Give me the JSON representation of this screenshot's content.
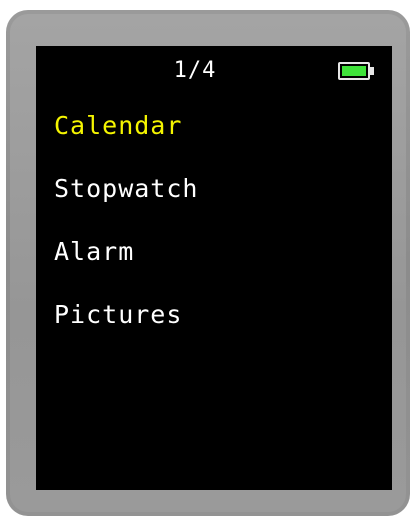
{
  "status": {
    "page_indicator": "1/4",
    "battery_level": 1.0,
    "battery_color": "#3fe23a",
    "battery_icon": "battery-icon"
  },
  "menu": {
    "selected_index": 0,
    "selected_color": "#f5f500",
    "items": [
      {
        "label": "Calendar"
      },
      {
        "label": "Stopwatch"
      },
      {
        "label": "Alarm"
      },
      {
        "label": "Pictures"
      }
    ]
  }
}
